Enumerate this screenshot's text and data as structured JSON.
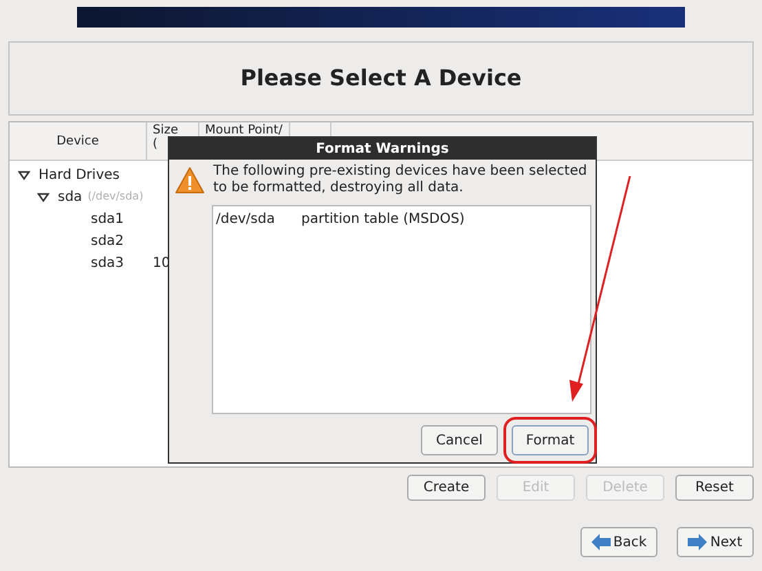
{
  "title": "Please Select A Device",
  "table": {
    "columns": [
      {
        "lines": [
          "Device"
        ]
      },
      {
        "lines": [
          "Size",
          "("
        ]
      },
      {
        "lines": [
          "Mount Point/"
        ]
      }
    ],
    "tree": [
      {
        "name": "Hard Drives",
        "expanded": true,
        "children": [
          {
            "name": "sda",
            "hint": "(/dev/sda)",
            "expanded": true,
            "children": [
              {
                "name": "sda1"
              },
              {
                "name": "sda2"
              },
              {
                "name": "sda3",
                "size": "10"
              }
            ]
          }
        ]
      }
    ]
  },
  "dialog": {
    "title": "Format Warnings",
    "message": "The following pre-existing devices have been selected to be formatted, destroying all data.",
    "items": [
      {
        "device": "/dev/sda",
        "description": "partition table (MSDOS)"
      }
    ],
    "buttons": [
      {
        "label": "Cancel",
        "highlighted": false
      },
      {
        "label": "Format",
        "highlighted": true
      }
    ]
  },
  "actions": [
    {
      "label": "Create",
      "disabled": false
    },
    {
      "label": "Edit",
      "disabled": true
    },
    {
      "label": "Delete",
      "disabled": true
    },
    {
      "label": "Reset",
      "disabled": false
    }
  ],
  "nav": [
    {
      "label": "Back",
      "kind": "back"
    },
    {
      "label": "Next",
      "kind": "next"
    }
  ]
}
